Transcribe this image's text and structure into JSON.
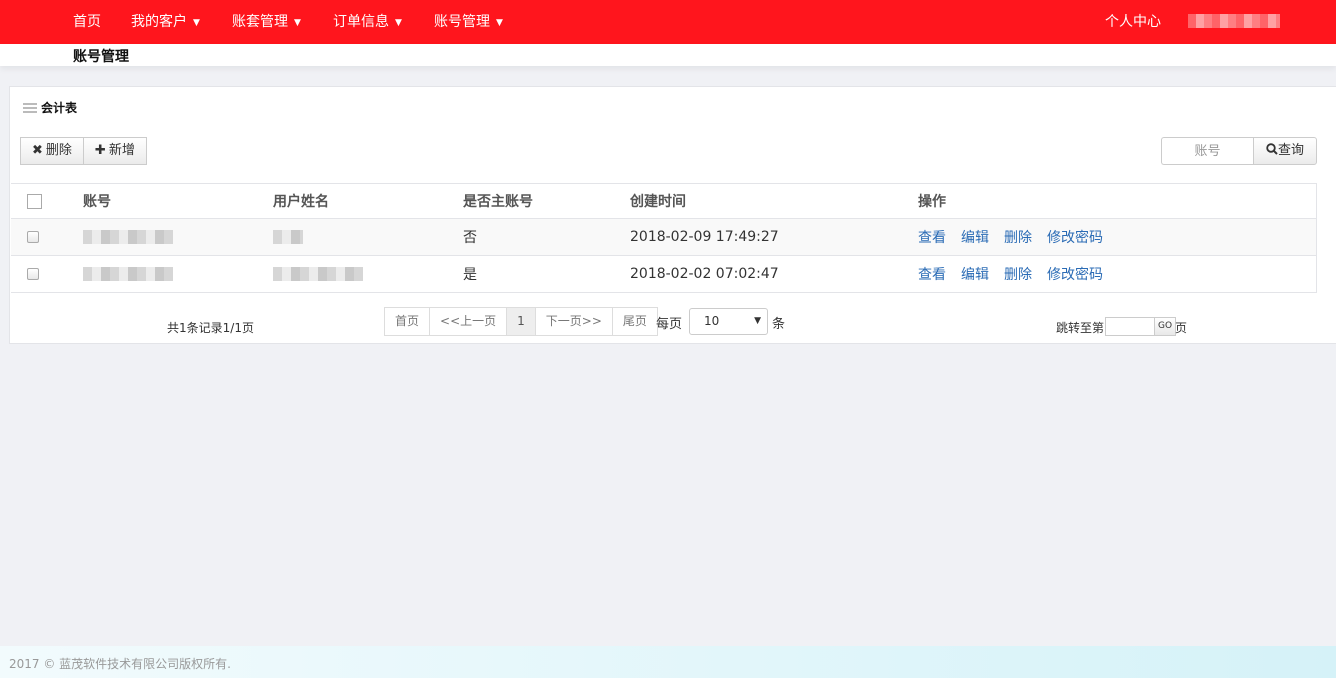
{
  "nav": {
    "home": "首页",
    "customers": "我的客户",
    "ledger": "账套管理",
    "orders": "订单信息",
    "accounts": "账号管理",
    "personal_center": "个人中心",
    "caret": "▼"
  },
  "page": {
    "title": "账号管理"
  },
  "panel": {
    "title": "会计表"
  },
  "toolbar": {
    "delete_icon": "✖",
    "delete_label": "删除",
    "add_icon": "✚",
    "add_label": "新增"
  },
  "search": {
    "placeholder": "账号",
    "button_label": "查询",
    "icon": "search-icon"
  },
  "table": {
    "columns": [
      "账号",
      "用户姓名",
      "是否主账号",
      "创建时间",
      "操作"
    ],
    "rows": [
      {
        "is_main": "否",
        "created": "2018-02-09 17:49:27"
      },
      {
        "is_main": "是",
        "created": "2018-02-02 07:02:47"
      }
    ],
    "actions": [
      "查看",
      "编辑",
      "删除",
      "修改密码"
    ]
  },
  "pager": {
    "summary": "共1条记录1/1页",
    "first": "首页",
    "prev": "<<上一页",
    "current": "1",
    "next": "下一页>>",
    "last": "尾页",
    "per_page_label": "每页",
    "per_page_value": "10",
    "per_page_unit": "条",
    "jump_label": "跳转至第",
    "go_label": "GO",
    "jump_suffix": "页"
  },
  "footer": {
    "copyright": "2017 © 蓝茂软件技术有限公司版权所有."
  },
  "colors": {
    "brand": "#ff151d",
    "link": "#2a6bb5"
  }
}
